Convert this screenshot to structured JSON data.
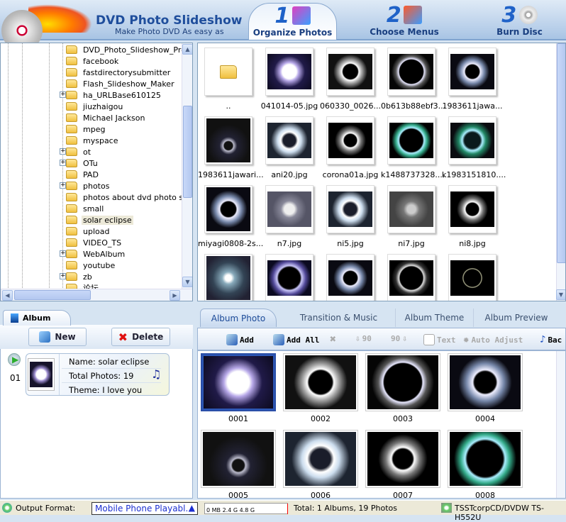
{
  "header": {
    "title": "DVD Photo Slideshow",
    "subtitle": "Make Photo DVD As easy as",
    "steps": [
      {
        "num": "1",
        "label": "Organize Photos"
      },
      {
        "num": "2",
        "label": "Choose Menus"
      },
      {
        "num": "3",
        "label": "Burn Disc"
      }
    ]
  },
  "tree": {
    "items": [
      {
        "label": "DVD_Photo_Slideshow_Pro",
        "expandable": false
      },
      {
        "label": "facebook",
        "expandable": false
      },
      {
        "label": "fastdirectorysubmitter",
        "expandable": false
      },
      {
        "label": "Flash_Slideshow_Maker",
        "expandable": false
      },
      {
        "label": "ha_URLBase610125",
        "expandable": true
      },
      {
        "label": "jiuzhaigou",
        "expandable": false
      },
      {
        "label": "Michael Jackson",
        "expandable": false
      },
      {
        "label": "mpeg",
        "expandable": false
      },
      {
        "label": "myspace",
        "expandable": false
      },
      {
        "label": "ot",
        "expandable": true
      },
      {
        "label": "OTu",
        "expandable": true
      },
      {
        "label": "PAD",
        "expandable": false
      },
      {
        "label": "photos",
        "expandable": true
      },
      {
        "label": "photos about dvd  photo slid",
        "expandable": false
      },
      {
        "label": "small",
        "expandable": false
      },
      {
        "label": "solar eclipse",
        "expandable": false,
        "selected": true
      },
      {
        "label": "upload",
        "expandable": false
      },
      {
        "label": "VIDEO_TS",
        "expandable": false
      },
      {
        "label": "WebAlbum",
        "expandable": true
      },
      {
        "label": "youtube",
        "expandable": false
      },
      {
        "label": "zb",
        "expandable": true
      },
      {
        "label": "论坛",
        "expandable": false
      }
    ]
  },
  "files": [
    "..",
    "041014-05.jpg",
    "060330_0026...",
    "0b613b88ebf3...",
    "1983611jawa...",
    "1983611jawari...",
    "ani20.jpg",
    "corona01a.jpg",
    "k1488737328....",
    "k1983151810....",
    "miyagi0808-2s...",
    "n7.jpg",
    "ni5.jpg",
    "ni7.jpg",
    "ni8.jpg",
    "",
    "",
    "",
    "",
    ""
  ],
  "album": {
    "tab_label": "Album",
    "new_label": "New",
    "delete_label": "Delete",
    "items": [
      {
        "index": "01",
        "name": "Name: solar eclipse",
        "total": "Total Photos: 19",
        "theme": "Theme: I love you"
      }
    ]
  },
  "tabs": [
    {
      "label": "Album Photo",
      "active": true
    },
    {
      "label": "Transition & Music"
    },
    {
      "label": "Album Theme"
    },
    {
      "label": "Album Preview"
    }
  ],
  "toolbar": {
    "add": "Add",
    "add_all": "Add All",
    "rotate_left": "90",
    "rotate_right": "90",
    "text": "Text",
    "auto_adjust": "Auto Adjust",
    "background_music": "Bac"
  },
  "photos": [
    "0001",
    "0002",
    "0003",
    "0004",
    "0005",
    "0006",
    "0007",
    "0008"
  ],
  "status": {
    "output_label": "Output Format:",
    "output_value": "Mobile Phone Playabl...",
    "scale": "0 MB  2.4 G  4.8 G",
    "total": "Total: 1 Albums, 19 Photos",
    "drive": "TSSTcorpCD/DVDW TS-H552U"
  },
  "colors": {
    "accent": "#1f62c8",
    "selection": "#2a4fa8",
    "panel_border": "#9bb3d3"
  }
}
